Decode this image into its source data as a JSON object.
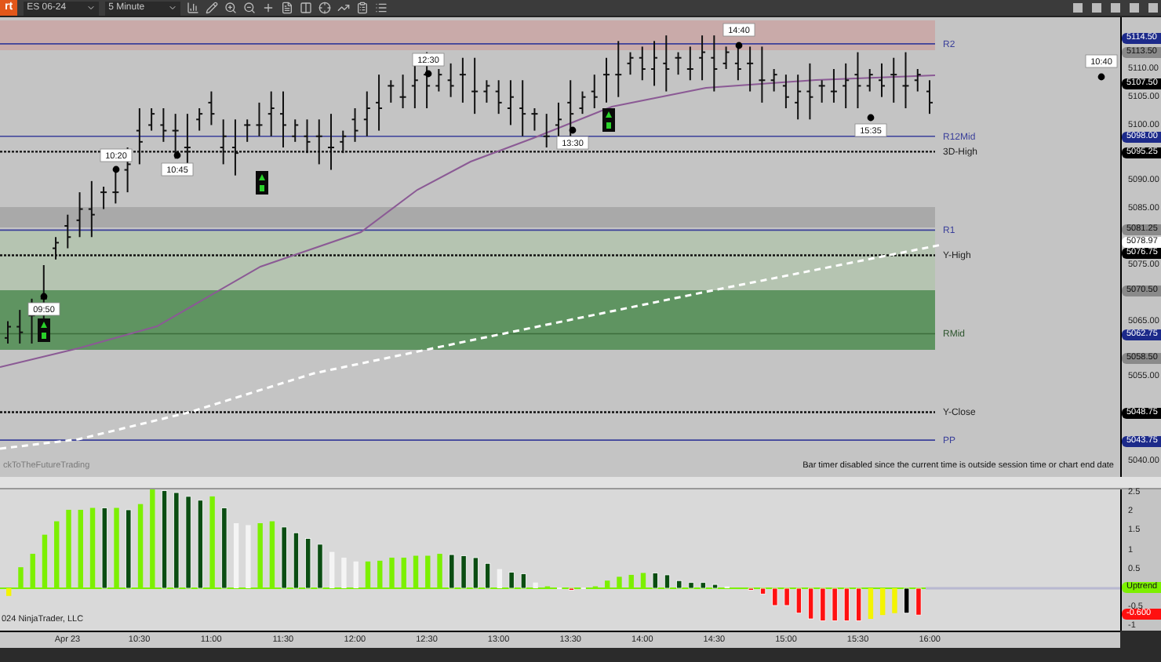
{
  "toolbar": {
    "chart_button": "rt",
    "instrument": "ES 06-24",
    "interval": "5 Minute"
  },
  "price_chart": {
    "levels": [
      {
        "label": "R2",
        "kind": "pivot"
      },
      {
        "label": "R12Mid",
        "kind": "pivot"
      },
      {
        "label": "3D-High",
        "kind": "session"
      },
      {
        "label": "R1",
        "kind": "pivot"
      },
      {
        "label": "Y-High",
        "kind": "session"
      },
      {
        "label": "RMid",
        "kind": "mid"
      },
      {
        "label": "Y-Close",
        "kind": "session"
      },
      {
        "label": "PP",
        "kind": "pivot"
      }
    ],
    "markers": [
      {
        "label": "09:50"
      },
      {
        "label": "10:20"
      },
      {
        "label": "10:45"
      },
      {
        "label": "12:30"
      },
      {
        "label": "13:30"
      },
      {
        "label": "14:40"
      },
      {
        "label": "15:35"
      },
      {
        "label": "10:40"
      }
    ],
    "branding": "ckToTheFutureTrading",
    "status_text": "Bar timer disabled since the current time is outside session time or chart end date"
  },
  "price_axis": {
    "ticks": [
      "5110.00",
      "5105.00",
      "5100.00",
      "5090.00",
      "5085.00",
      "5075.00",
      "5065.00",
      "5055.00",
      "5040.00"
    ],
    "flags": [
      {
        "label": "5114.50",
        "color": "#1c2a8a"
      },
      {
        "label": "5113.50",
        "color": "#8a8a8a"
      },
      {
        "label": "5107.50",
        "color": "#000000"
      },
      {
        "label": "5098.00",
        "color": "#1c2a8a"
      },
      {
        "label": "5095.25",
        "color": "#000000"
      },
      {
        "label": "5081.25",
        "color": "#8a8a8a"
      },
      {
        "label": "5078.97",
        "color": "#ffffff"
      },
      {
        "label": "5076.75",
        "color": "#000000"
      },
      {
        "label": "5070.50",
        "color": "#8a8a8a"
      },
      {
        "label": "5062.75",
        "color": "#1c2a8a"
      },
      {
        "label": "5058.50",
        "color": "#8a8a8a"
      },
      {
        "label": "5048.75",
        "color": "#000000"
      },
      {
        "label": "5043.75",
        "color": "#1c2a8a"
      }
    ]
  },
  "oscillator": {
    "copyright": "024 NinjaTrader, LLC",
    "ticks": [
      "2.5",
      "2",
      "1.5",
      "1",
      "0.5",
      "-0.5",
      "-1"
    ],
    "trend_flag": "Uptrend",
    "value_flag": "-0.600"
  },
  "time_axis": [
    "Apr 23",
    "10:30",
    "11:00",
    "11:30",
    "12:00",
    "12:30",
    "13:00",
    "13:30",
    "14:00",
    "14:30",
    "15:00",
    "15:30",
    "16:00"
  ]
}
